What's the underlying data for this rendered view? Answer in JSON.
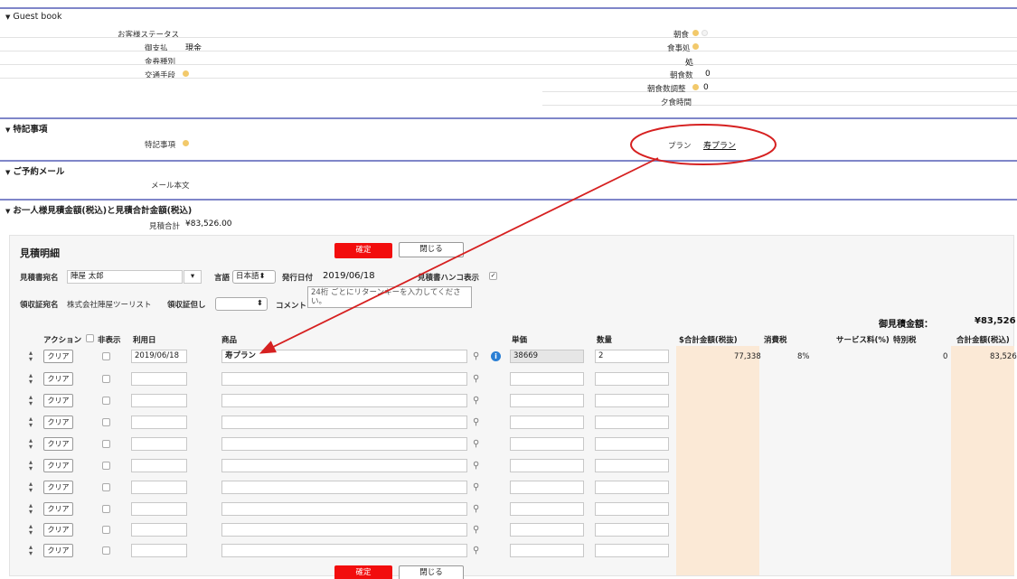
{
  "guestbook": {
    "title": "Guest book",
    "customer_status_label": "お客様ステータス",
    "payment_label": "御支払",
    "payment_value": "現金",
    "voucher_label": "金券種別",
    "transport_label": "交通手段",
    "breakfast_label": "朝食",
    "dining_place_label": "食事処",
    "place_value": "処",
    "breakfast_count_label": "朝食数",
    "breakfast_count_value": "0",
    "breakfast_adjust_label": "朝食数調整",
    "breakfast_adjust_value": "0",
    "dinner_time_label": "夕食時間"
  },
  "notes": {
    "title": "特記事項",
    "notes_label": "特記事項",
    "plan_label": "プラン",
    "plan_value": "寿プラン"
  },
  "mail": {
    "title": "ご予約メール",
    "body_label": "メール本文"
  },
  "estimate": {
    "title": "お一人様見積金額(税込)と見積合計金額(税込)",
    "total_label": "見積合計",
    "total_value": "¥83,526.00"
  },
  "panel": {
    "title": "見積明細",
    "confirm_label": "確定",
    "close_label": "閉じる",
    "addressee_label": "見積書宛名",
    "addressee_value": "陣屋 太郎",
    "language_label": "言語",
    "language_value": "日本語",
    "issue_date_label": "発行日付",
    "issue_date_value": "2019/06/18",
    "hanko_label": "見積書ハンコ表示",
    "receipt_name_label": "領収証宛名",
    "receipt_name_value": "株式会社陣屋ツーリスト",
    "receipt_note_label": "領収証但し",
    "comment_label": "コメント",
    "comment_placeholder": "24桁 ごとにリターンキーを入力してください。",
    "grand_total_label": "御見積金額：",
    "grand_total_value": "¥83,526"
  },
  "table": {
    "headers": {
      "action": "アクション",
      "hide": "非表示",
      "date": "利用日",
      "product": "商品",
      "unit_price": "単価",
      "quantity": "数量",
      "subtotal": "$合計金額(税抜)",
      "consumption_tax": "消費税",
      "service": "サービス料(%)",
      "special_tax": "特別税",
      "total": "合計金額(税込)"
    },
    "clear_label": "クリア",
    "first_row": {
      "date": "2019/06/18",
      "product": "寿プラン",
      "unit_price": "38669",
      "quantity": "2",
      "subtotal": "77,338",
      "tax": "8%",
      "special_tax": "0",
      "total": "83,526"
    }
  },
  "colors": {
    "section_line": "#7f86c9",
    "confirm_red": "#f20d0d",
    "annotation_red": "#d62020",
    "peach": "#fbe9d6"
  }
}
